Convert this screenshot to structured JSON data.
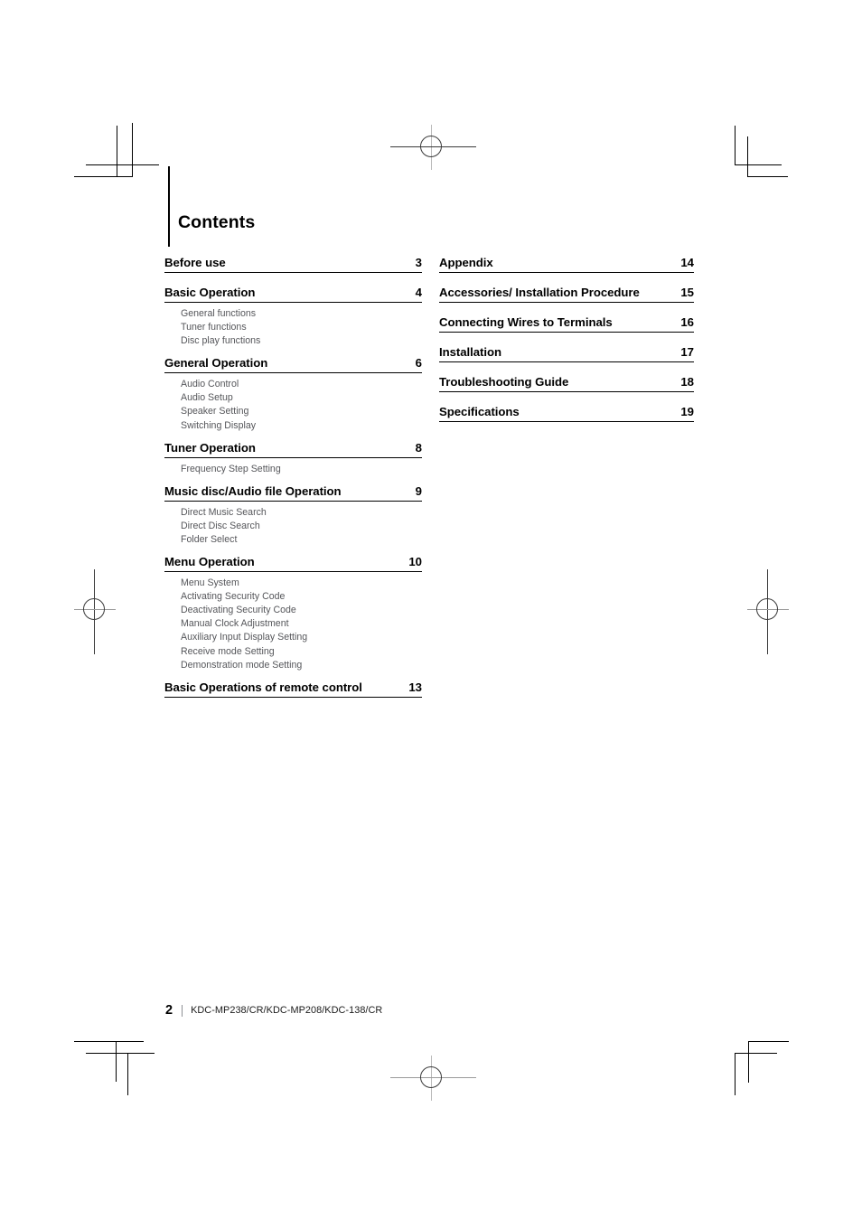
{
  "document": {
    "page_title": "Contents",
    "footer": {
      "page_number": "2",
      "model_line": "KDC-MP238/CR/KDC-MP208/KDC-138/CR"
    }
  },
  "toc": {
    "left_column": [
      {
        "title": "Before use",
        "page": "3",
        "subitems": []
      },
      {
        "title": "Basic Operation",
        "page": "4",
        "subitems": [
          "General functions",
          "Tuner functions",
          "Disc play functions"
        ]
      },
      {
        "title": "General Operation",
        "page": "6",
        "subitems": [
          "Audio Control",
          "Audio Setup",
          "Speaker Setting",
          "Switching Display"
        ]
      },
      {
        "title": "Tuner Operation",
        "page": "8",
        "subitems": [
          "Frequency Step Setting"
        ]
      },
      {
        "title": "Music disc/Audio file Operation",
        "page": "9",
        "subitems": [
          "Direct Music Search",
          "Direct Disc Search",
          "Folder Select"
        ]
      },
      {
        "title": "Menu Operation",
        "page": "10",
        "subitems": [
          "Menu System",
          "Activating Security Code",
          "Deactivating Security Code",
          "Manual Clock Adjustment",
          "Auxiliary Input Display Setting",
          "Receive mode Setting",
          "Demonstration mode Setting"
        ]
      },
      {
        "title": "Basic Operations of remote control",
        "page": "13",
        "subitems": []
      }
    ],
    "right_column": [
      {
        "title": "Appendix",
        "page": "14",
        "subitems": []
      },
      {
        "title": "Accessories/ Installation Procedure",
        "page": "15",
        "subitems": []
      },
      {
        "title": "Connecting Wires to Terminals",
        "page": "16",
        "subitems": []
      },
      {
        "title": "Installation",
        "page": "17",
        "subitems": []
      },
      {
        "title": "Troubleshooting Guide",
        "page": "18",
        "subitems": []
      },
      {
        "title": "Specifications",
        "page": "19",
        "subitems": []
      }
    ]
  },
  "printers_marks": {
    "registration_mark_icon": "registration-target-icon",
    "crop_mark_icon": "crop-corner-icon",
    "mark_color": "#000000",
    "registration_line_color": "#3a3a3a",
    "registration_secondary_color": "#b0b0b0"
  },
  "colors": {
    "page_background": "#ffffff",
    "heading_text": "#000000",
    "subitem_text": "#55565a",
    "rule": "#000000"
  }
}
